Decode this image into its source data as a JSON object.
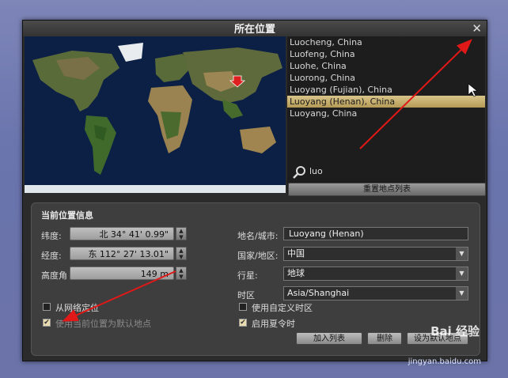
{
  "window": {
    "title": "所在位置",
    "close_glyph": "✕"
  },
  "map": {
    "marker_color": "#e02020"
  },
  "locations": [
    {
      "name": "Luocheng, China",
      "selected": false
    },
    {
      "name": "Luofeng, China",
      "selected": false
    },
    {
      "name": "Luohe, China",
      "selected": false
    },
    {
      "name": "Luorong, China",
      "selected": false
    },
    {
      "name": "Luoyang (Fujian), China",
      "selected": false
    },
    {
      "name": "Luoyang (Henan), China",
      "selected": true
    },
    {
      "name": "Luoyang, China",
      "selected": false
    }
  ],
  "search": {
    "value": "luo",
    "icon": "search-icon"
  },
  "reset_button": "重置地点列表",
  "panel": {
    "title": "当前位置信息",
    "latitude": {
      "label": "纬度:",
      "value": "北 34° 41' 0.99\""
    },
    "longitude": {
      "label": "经度:",
      "value": "东 112° 27' 13.01\""
    },
    "altitude": {
      "label": "高度角",
      "value": "149 m"
    },
    "name_city": {
      "label": "地名/城市:",
      "value": "Luoyang (Henan)"
    },
    "country": {
      "label": "国家/地区:",
      "value": "中国"
    },
    "planet": {
      "label": "行星:",
      "value": "地球"
    },
    "timezone": {
      "label": "时区",
      "value": "Asia/Shanghai"
    },
    "check_network": {
      "label": "从网络定位",
      "checked": false
    },
    "check_default": {
      "label": "使用当前位置为默认地点",
      "checked": true
    },
    "check_custom_tz": {
      "label": "使用自定义时区",
      "checked": false
    },
    "check_dst": {
      "label": "启用夏令时",
      "checked": true
    },
    "add_button": "加入列表",
    "delete_button": "删除",
    "default_button": "设为默认地点"
  },
  "watermark": {
    "brand": "Bai 经验",
    "url": "jingyan.baidu.com"
  },
  "annotation_color": "#e01818"
}
